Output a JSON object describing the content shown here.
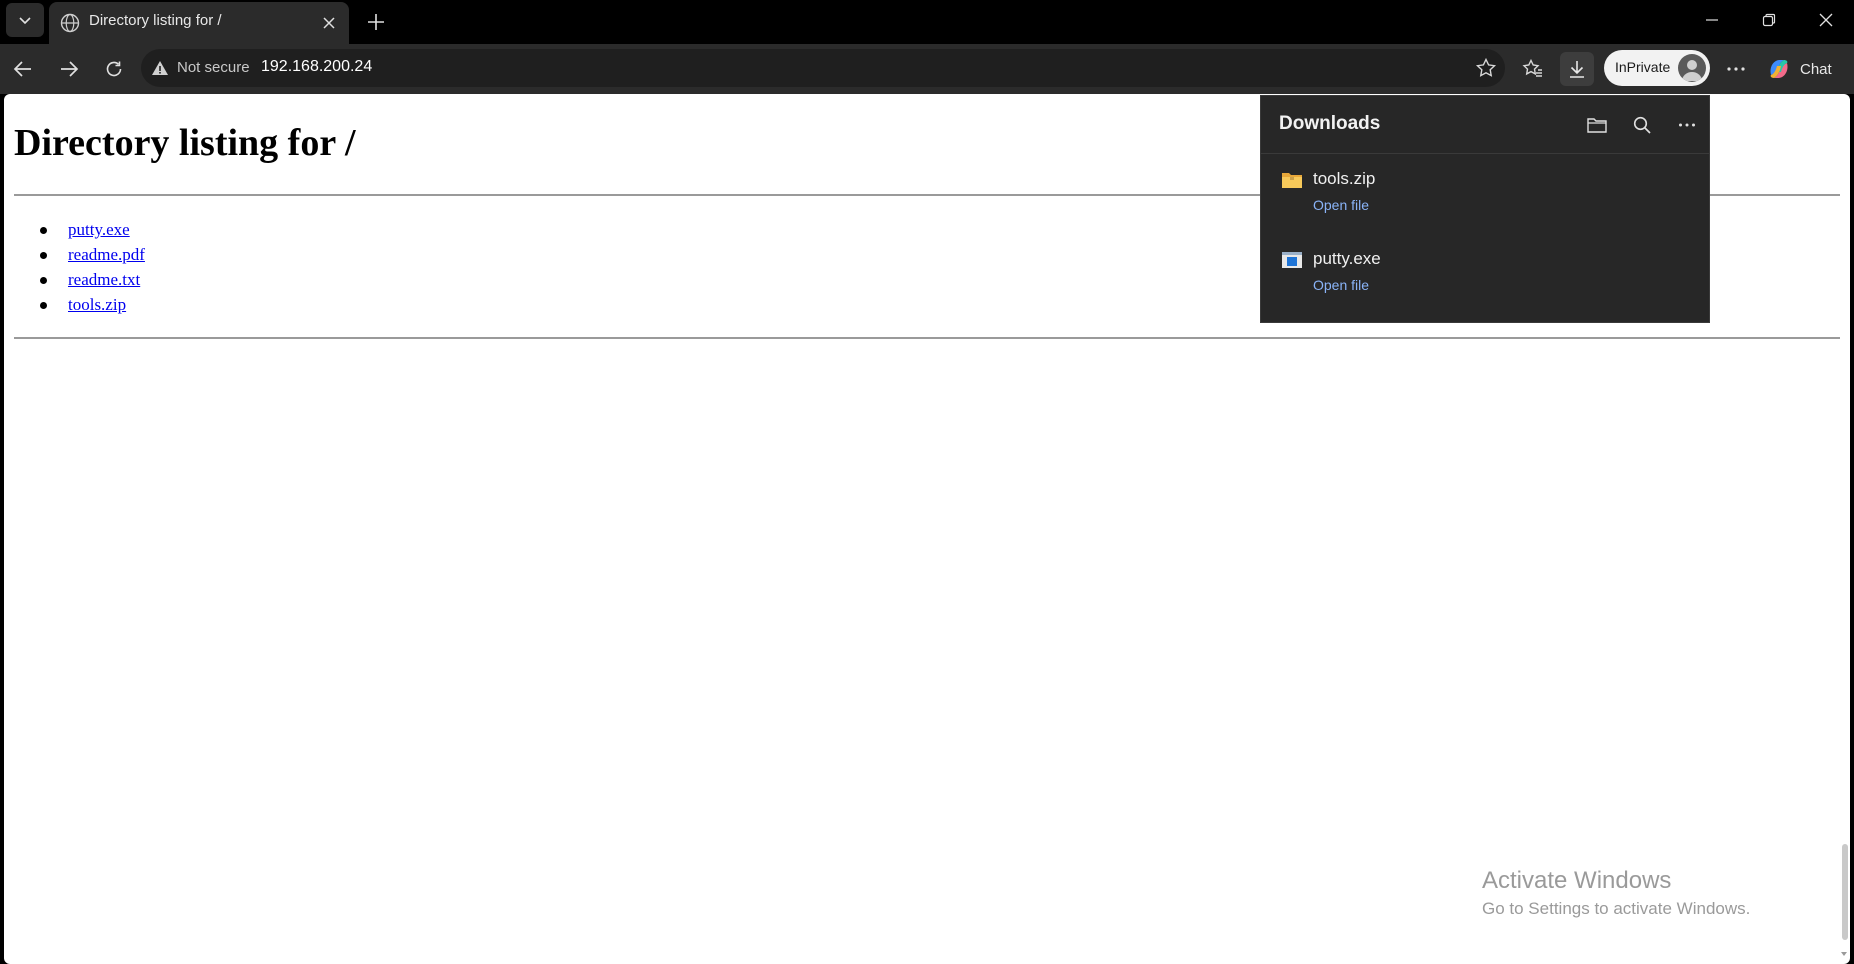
{
  "tab": {
    "title": "Directory listing for /"
  },
  "toolbar": {
    "security_label": "Not secure",
    "url": "192.168.200.24",
    "inprivate_label": "InPrivate",
    "chat_label": "Chat"
  },
  "page": {
    "title": "Directory listing for /",
    "files": [
      "putty.exe",
      "readme.pdf",
      "readme.txt",
      "tools.zip"
    ]
  },
  "downloads": {
    "title": "Downloads",
    "items": [
      {
        "name": "tools.zip",
        "action": "Open file",
        "icon": "folder-zip-icon"
      },
      {
        "name": "putty.exe",
        "action": "Open file",
        "icon": "exe-file-icon"
      }
    ]
  },
  "watermark": {
    "line1": "Activate Windows",
    "line2": "Go to Settings to activate Windows."
  },
  "colors": {
    "chrome_bg": "#000000",
    "toolbar_bg": "#2b2b2b",
    "link": "#0000ee",
    "flyout_bg": "#272727",
    "flyout_link": "#8ab4f8"
  }
}
